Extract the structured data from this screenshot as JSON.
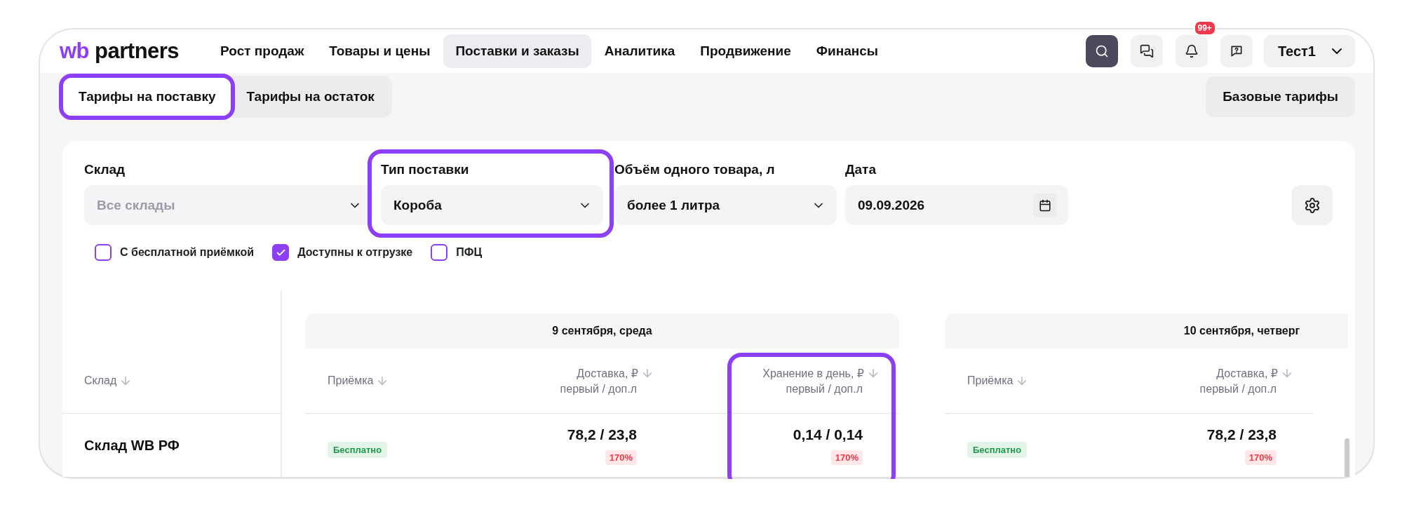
{
  "header": {
    "logo": {
      "mark": "wb",
      "name": "partners"
    },
    "nav": [
      {
        "label": "Рост продаж",
        "selected": false
      },
      {
        "label": "Товары и цены",
        "selected": false
      },
      {
        "label": "Поставки и заказы",
        "selected": true
      },
      {
        "label": "Аналитика",
        "selected": false
      },
      {
        "label": "Продвижение",
        "selected": false
      },
      {
        "label": "Финансы",
        "selected": false
      }
    ],
    "notifications_badge": "99+",
    "user": "Тест1"
  },
  "tabs": [
    {
      "label": "Тарифы на поставку",
      "selected": true,
      "highlighted": true
    },
    {
      "label": "Тарифы на остаток",
      "selected": false,
      "highlighted": false
    }
  ],
  "base_rates_button": "Базовые тарифы",
  "filters": [
    {
      "kind": "select",
      "label": "Склад",
      "placeholder": "Все склады",
      "highlighted": false
    },
    {
      "kind": "select",
      "label": "Тип поставки",
      "value": "Короба",
      "highlighted": true
    },
    {
      "kind": "select",
      "label": "Объём одного товара, л",
      "value": "более 1 литра",
      "highlighted": false
    },
    {
      "kind": "date",
      "label": "Дата",
      "value": "09.09.2026",
      "highlighted": false
    }
  ],
  "checkboxes": [
    {
      "label": "С бесплатной приёмкой",
      "checked": false
    },
    {
      "label": "Доступны к отгрузке",
      "checked": true
    },
    {
      "label": "ПФЦ",
      "checked": false
    }
  ],
  "table": {
    "warehouse_header": "Склад",
    "warehouse": "Склад WB РФ",
    "days": [
      {
        "title": "9 сентября, среда",
        "columns": [
          {
            "kind": "acceptance",
            "title": "Приёмка",
            "value": "Бесплатно",
            "highlighted": false
          },
          {
            "kind": "rate",
            "title": "Доставка, ₽",
            "subtitle": "первый / доп.л",
            "value": "78,2 / 23,8",
            "coefficient": "170%",
            "highlighted": false
          },
          {
            "kind": "rate",
            "title": "Хранение в день, ₽",
            "subtitle": "первый / доп.л",
            "value": "0,14 / 0,14",
            "coefficient": "170%",
            "highlighted": true
          }
        ]
      },
      {
        "title": "10 сентября, четверг",
        "columns": [
          {
            "kind": "acceptance",
            "title": "Приёмка",
            "value": "Бесплатно",
            "highlighted": false
          },
          {
            "kind": "rate",
            "title": "Доставка, ₽",
            "subtitle": "первый / доп.л",
            "value": "78,2 / 23,8",
            "coefficient": "170%",
            "highlighted": false
          }
        ]
      }
    ]
  }
}
